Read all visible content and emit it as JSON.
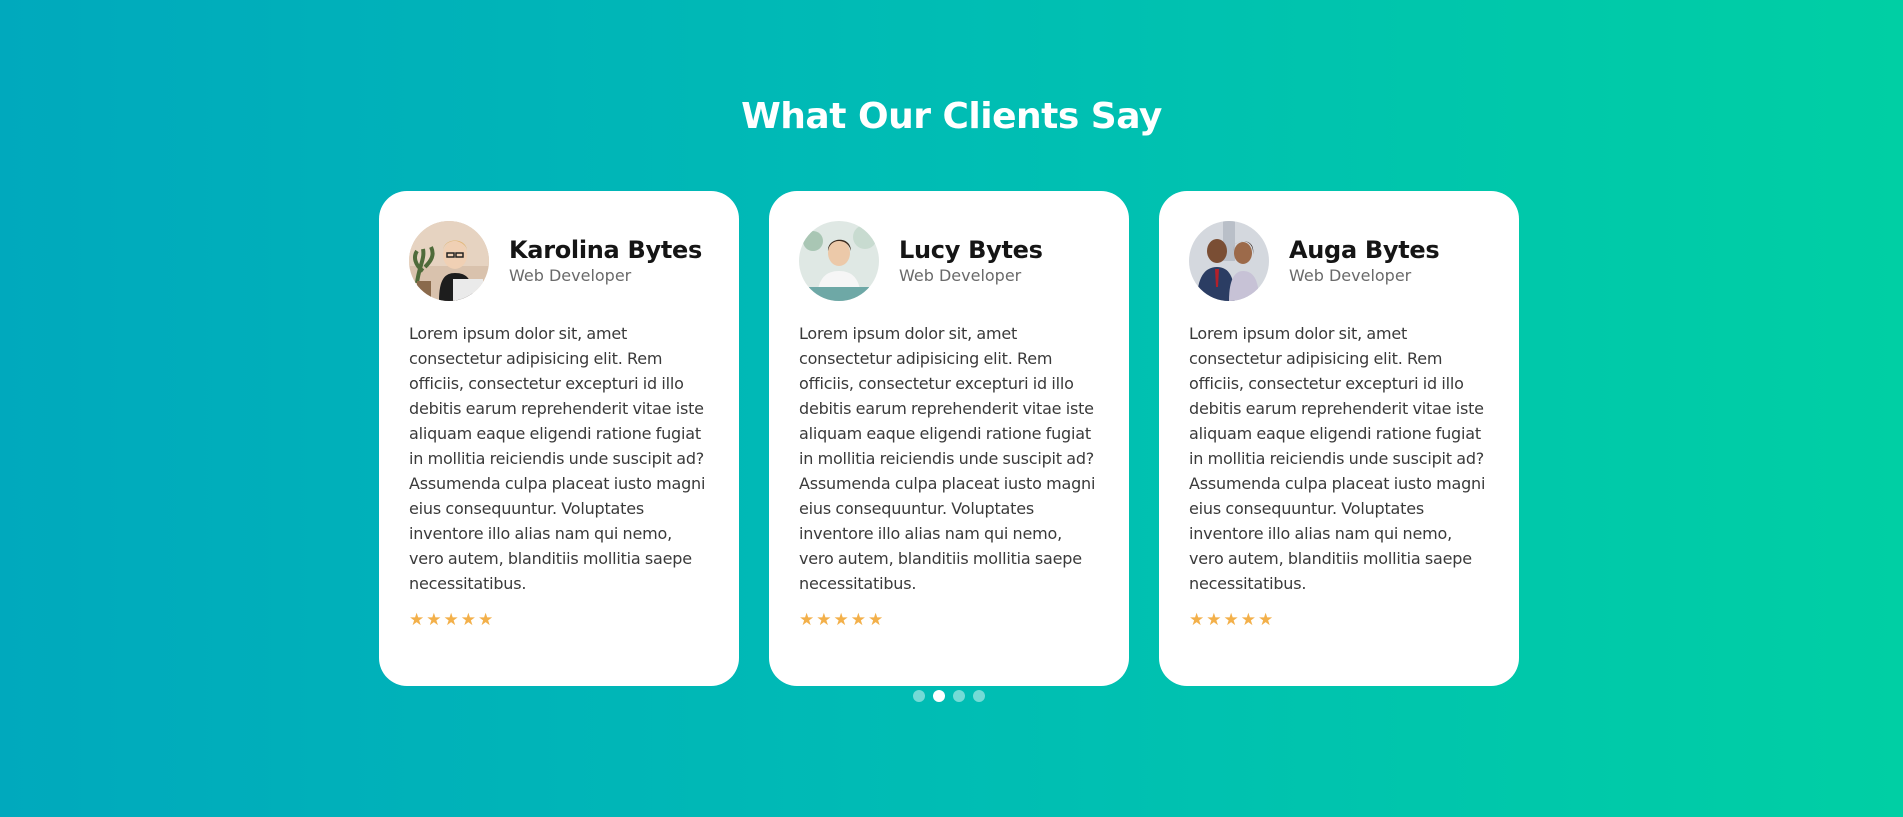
{
  "section": {
    "title": "What Our Clients Say"
  },
  "testimonials": [
    {
      "name": "Karolina Bytes",
      "role": "Web Developer",
      "text": "Lorem ipsum dolor sit, amet consectetur adipisicing elit. Rem officiis, consectetur excepturi id illo debitis earum reprehenderit vitae iste aliquam eaque eligendi ratione fugiat in mollitia reiciendis unde suscipit ad? Assumenda culpa placeat iusto magni eius consequuntur. Voluptates inventore illo alias nam qui nemo, vero autem, blanditiis mollitia saepe necessitatibus.",
      "rating": 5
    },
    {
      "name": "Lucy Bytes",
      "role": "Web Developer",
      "text": "Lorem ipsum dolor sit, amet consectetur adipisicing elit. Rem officiis, consectetur excepturi id illo debitis earum reprehenderit vitae iste aliquam eaque eligendi ratione fugiat in mollitia reiciendis unde suscipit ad? Assumenda culpa placeat iusto magni eius consequuntur. Voluptates inventore illo alias nam qui nemo, vero autem, blanditiis mollitia saepe necessitatibus.",
      "rating": 5
    },
    {
      "name": "Auga Bytes",
      "role": "Web Developer",
      "text": "Lorem ipsum dolor sit, amet consectetur adipisicing elit. Rem officiis, consectetur excepturi id illo debitis earum reprehenderit vitae iste aliquam eaque eligendi ratione fugiat in mollitia reiciendis unde suscipit ad? Assumenda culpa placeat iusto magni eius consequuntur. Voluptates inventore illo alias nam qui nemo, vero autem, blanditiis mollitia saepe necessitatibus.",
      "rating": 5
    }
  ],
  "carousel": {
    "slide_count": 4,
    "active_index": 1
  },
  "colors": {
    "background_start": "#00a9bd",
    "background_end": "#00cfa4",
    "star": "#f3b04a",
    "card": "#ffffff"
  },
  "icons": {
    "star": "star-icon"
  }
}
